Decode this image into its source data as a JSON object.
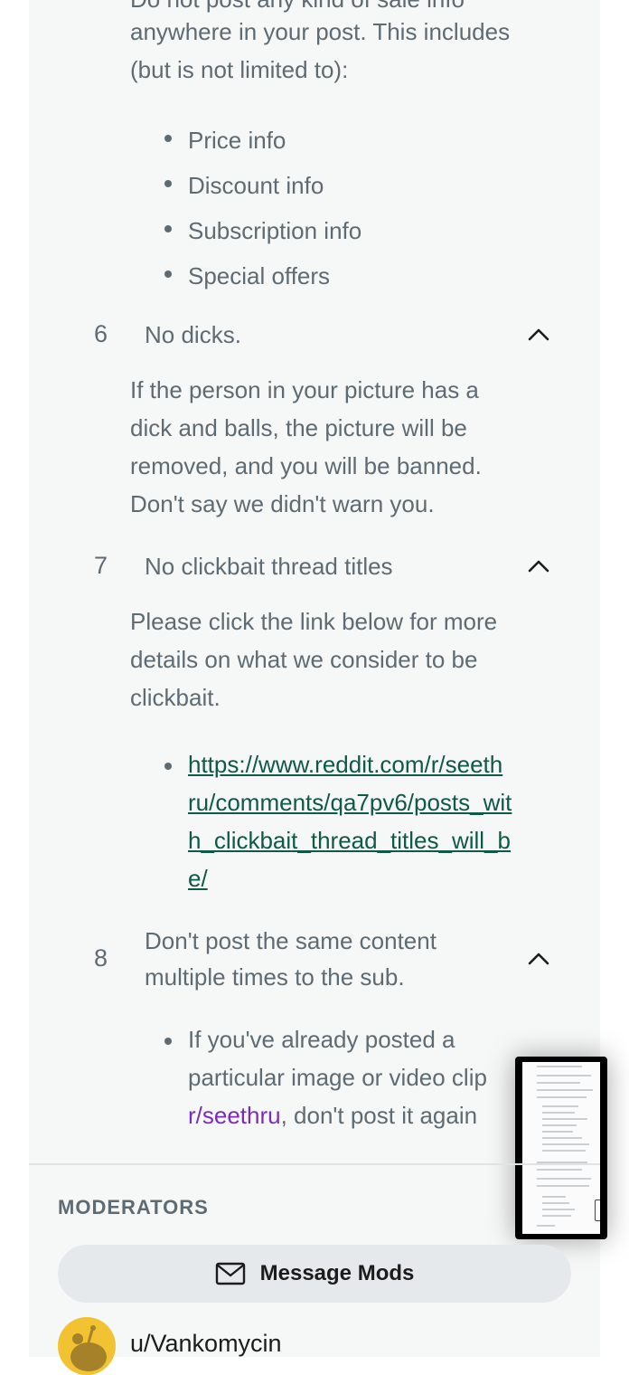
{
  "rule5": {
    "partial_line": "Do not post any kind of sale info",
    "body": [
      "anywhere in your post. This includes",
      "(but is not limited to):"
    ],
    "bullets": [
      "Price info",
      "Discount info",
      "Subscription info",
      "Special offers"
    ]
  },
  "rule6": {
    "number": "6",
    "title": "No dicks.",
    "body": [
      "If the person in your picture has a",
      "dick and balls, the picture will be",
      "removed, and you will be banned.",
      "Don't say we didn't warn you."
    ]
  },
  "rule7": {
    "number": "7",
    "title": "No clickbait thread titles",
    "body": [
      "Please click the link below for more",
      "details on what we consider to be",
      "clickbait."
    ],
    "link_lines": [
      "https://www.reddit.com/r/seeth",
      "ru/comments/qa7pv6/posts_wit",
      "h_clickbait_thread_titles_will_b",
      "e/"
    ]
  },
  "rule8": {
    "number": "8",
    "title_lines": [
      "Don't post the same content",
      "multiple times to the sub."
    ],
    "bullet_line1": "If you've already posted a",
    "bullet_line2": "particular image or video clip",
    "bullet_link": "r/seethru",
    "bullet_line3_rest": ", don't post it again"
  },
  "moderators": {
    "label": "MODERATORS",
    "message_button": "Message Mods",
    "first_mod": "u/Vankomycin"
  },
  "icons": {
    "chevron": "chevron-up-icon",
    "mail": "mail-icon"
  },
  "colors": {
    "text": "#5f6b73",
    "link": "#0e5a46",
    "subreddit_link": "#7b2cbf",
    "panel_bg": "#f6f7f7"
  }
}
